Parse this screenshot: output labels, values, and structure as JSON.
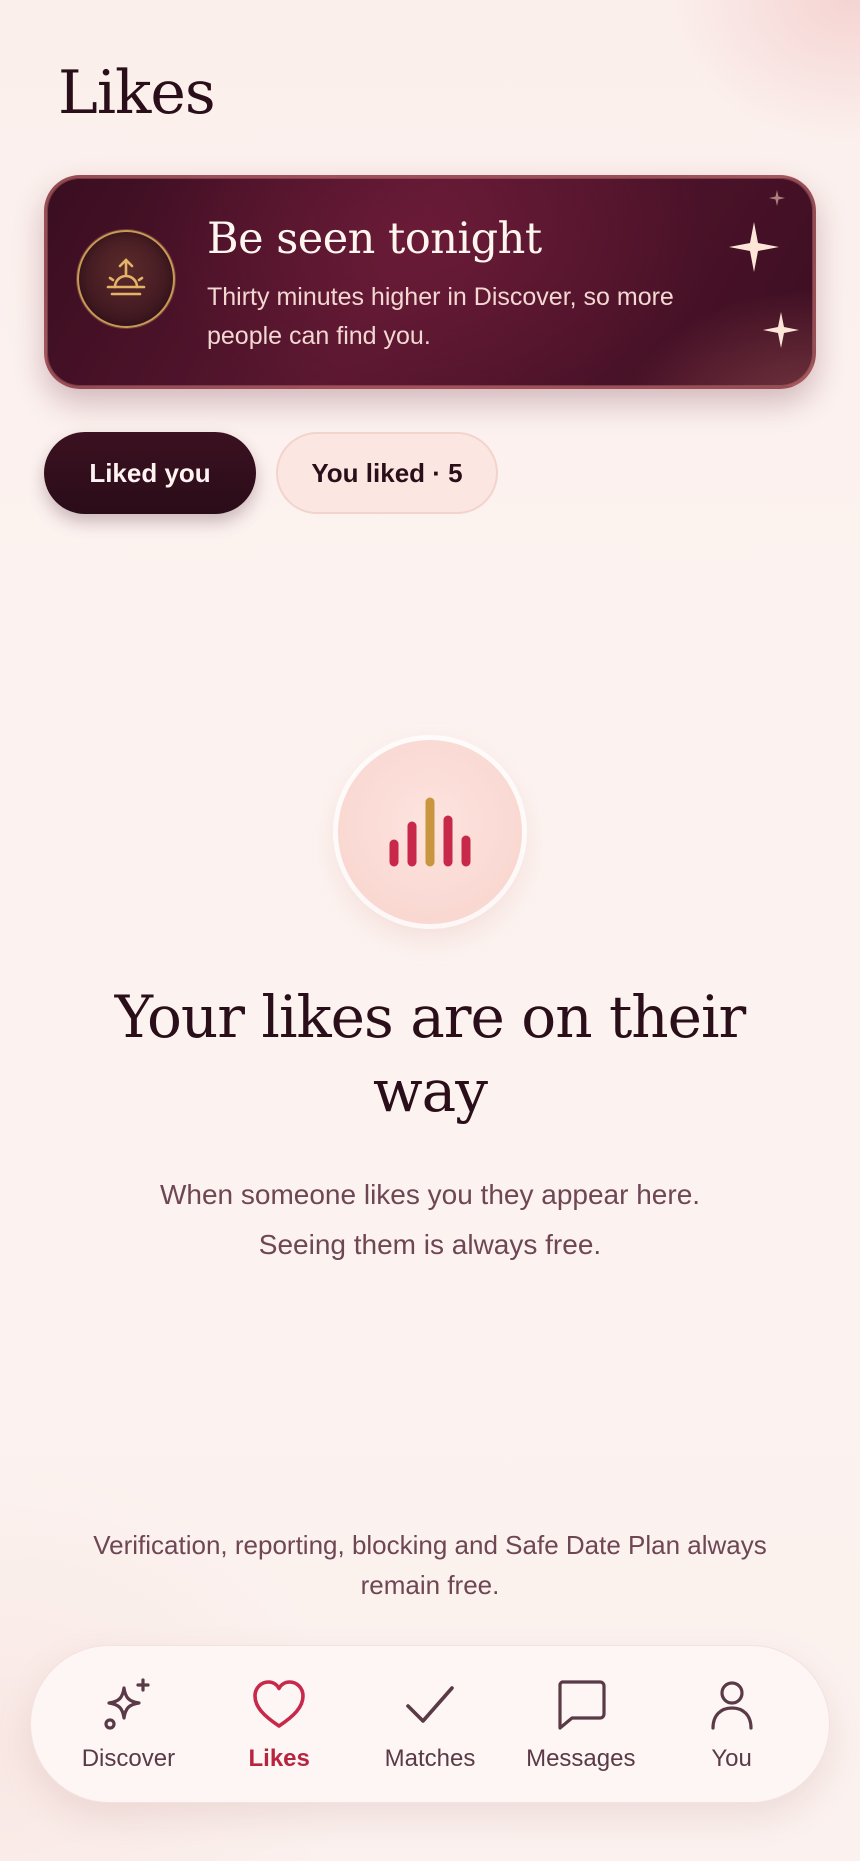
{
  "page": {
    "title": "Likes"
  },
  "boost_banner": {
    "heading": "Be seen tonight",
    "body": "Thirty minutes higher in Discover, so more people can find you.",
    "icon": "boost-sunrise-icon"
  },
  "tabs": [
    {
      "label": "Liked you",
      "active": true
    },
    {
      "label": "You liked · 5",
      "active": false
    }
  ],
  "empty_state": {
    "icon": "signal-bars-icon",
    "title": "Your likes are on their way",
    "text": "When someone likes you they appear here. Seeing them is always free."
  },
  "safety_note": "Verification, reporting, blocking and Safe Date Plan always remain free.",
  "bottom_nav": {
    "items": [
      {
        "label": "Discover",
        "icon": "sparkle-icon",
        "active": false
      },
      {
        "label": "Likes",
        "icon": "heart-icon",
        "active": true
      },
      {
        "label": "Matches",
        "icon": "checkmark-icon",
        "active": false
      },
      {
        "label": "Messages",
        "icon": "chat-bubble-icon",
        "active": false
      },
      {
        "label": "You",
        "icon": "person-icon",
        "active": false
      }
    ]
  },
  "colors": {
    "background": "#fbf1ee",
    "banner": "#4a1228",
    "accent": "#b8243e",
    "gold": "#c9963f",
    "text_dark": "#2a0f1a",
    "text_muted": "#6e4654"
  }
}
